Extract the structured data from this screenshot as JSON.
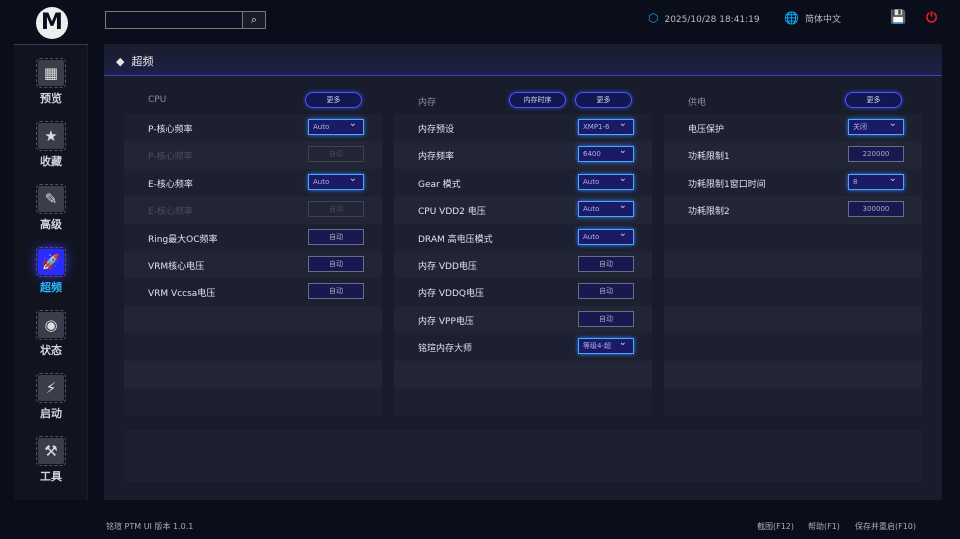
{
  "app": {
    "logo": "M",
    "version": "铭瑄 PTM UI 版本 1.0.1"
  },
  "topbar": {
    "search_placeholder": "",
    "datetime": "2025/10/28 18:41:19",
    "language": "简体中文"
  },
  "sidebar": [
    {
      "label": "预览",
      "icon": "grid-icon",
      "glyph": "▦"
    },
    {
      "label": "收藏",
      "icon": "star-icon",
      "glyph": "★"
    },
    {
      "label": "高级",
      "icon": "wrench-icon",
      "glyph": "✎"
    },
    {
      "label": "超频",
      "icon": "rocket-icon",
      "glyph": "🚀",
      "active": true
    },
    {
      "label": "状态",
      "icon": "eye-icon",
      "glyph": "◉"
    },
    {
      "label": "启动",
      "icon": "ssd-icon",
      "glyph": "⚡"
    },
    {
      "label": "工具",
      "icon": "hammer-icon",
      "glyph": "⚒"
    }
  ],
  "panel": {
    "title": "超频"
  },
  "columns": [
    {
      "title": "CPU",
      "buttons": [
        "更多"
      ],
      "rows": [
        {
          "label": "P-核心频率",
          "type": "dropdown",
          "value": "Auto"
        },
        {
          "label": "P-核心频率",
          "type": "button",
          "value": "自动",
          "disabled": true
        },
        {
          "label": "E-核心频率",
          "type": "dropdown",
          "value": "Auto"
        },
        {
          "label": "E-核心频率",
          "type": "button",
          "value": "自动",
          "disabled": true
        },
        {
          "label": "Ring最大OC频率",
          "type": "button",
          "value": "自动"
        },
        {
          "label": "VRM核心电压",
          "type": "button",
          "value": "自动"
        },
        {
          "label": "VRM Vccsa电压",
          "type": "button",
          "value": "自动"
        }
      ]
    },
    {
      "title": "内存",
      "buttons": [
        "内存时序",
        "更多"
      ],
      "rows": [
        {
          "label": "内存预设",
          "type": "dropdown",
          "value": "XMP1-6"
        },
        {
          "label": "内存频率",
          "type": "dropdown",
          "value": "6400"
        },
        {
          "label": "Gear 模式",
          "type": "dropdown",
          "value": "Auto"
        },
        {
          "label": "CPU VDD2 电压",
          "type": "dropdown",
          "value": "Auto"
        },
        {
          "label": "DRAM 高电压模式",
          "type": "dropdown",
          "value": "Auto"
        },
        {
          "label": "内存 VDD电压",
          "type": "button",
          "value": "自动"
        },
        {
          "label": "内存 VDDQ电压",
          "type": "button",
          "value": "自动"
        },
        {
          "label": "内存 VPP电压",
          "type": "button",
          "value": "自动"
        },
        {
          "label": "铭瑄内存大师",
          "type": "dropdown",
          "value": "等级4-超"
        }
      ]
    },
    {
      "title": "供电",
      "buttons": [
        "更多"
      ],
      "rows": [
        {
          "label": "电压保护",
          "type": "dropdown",
          "value": "关闭"
        },
        {
          "label": "功耗限制1",
          "type": "button",
          "value": "220000"
        },
        {
          "label": "功耗限制1窗口时间",
          "type": "dropdown",
          "value": "8"
        },
        {
          "label": "功耗限制2",
          "type": "button",
          "value": "300000"
        }
      ]
    }
  ],
  "footer": {
    "screenshot": "截图(F12)",
    "help": "帮助(F1)",
    "save": "保存并重启(F10)"
  },
  "colors": {
    "accent": "#4456ff",
    "active": "#2ab8ff",
    "power": "#e02020"
  }
}
